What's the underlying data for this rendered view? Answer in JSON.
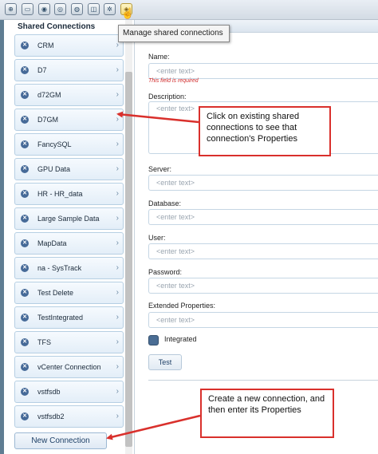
{
  "toolbar": {
    "tooltip": "Manage shared connections"
  },
  "sidebar": {
    "title": "Shared Connections",
    "items": [
      {
        "label": "CRM"
      },
      {
        "label": "D7"
      },
      {
        "label": "d72GM"
      },
      {
        "label": "D7GM"
      },
      {
        "label": "FancySQL"
      },
      {
        "label": "GPU Data"
      },
      {
        "label": "HR - HR_data"
      },
      {
        "label": "Large Sample Data"
      },
      {
        "label": "MapData"
      },
      {
        "label": "na - SysTrack"
      },
      {
        "label": "Test Delete"
      },
      {
        "label": "TestIntegrated"
      },
      {
        "label": "TFS"
      },
      {
        "label": "vCenter Connection"
      },
      {
        "label": "vstfsdb"
      },
      {
        "label": "vstfsdb2"
      }
    ],
    "new_connection_label": "New Connection"
  },
  "form": {
    "name_label": "Name:",
    "name_placeholder": "<enter text>",
    "required_msg": "This field is required",
    "description_label": "Description:",
    "description_placeholder": "<enter text>",
    "server_label": "Server:",
    "server_placeholder": "<enter text>",
    "database_label": "Database:",
    "database_placeholder": "<enter text>",
    "user_label": "User:",
    "user_placeholder": "<enter text>",
    "password_label": "Password:",
    "password_placeholder": "<enter text>",
    "extended_label": "Extended Properties:",
    "extended_placeholder": "<enter text>",
    "integrated_label": "Integrated",
    "integrated_checked": true,
    "test_button": "Test"
  },
  "callouts": {
    "existing": "Click on existing shared connections to see that connection's Properties",
    "new": "Create a new connection, and then enter its Properties"
  },
  "colors": {
    "callout_border": "#d9302c",
    "connection_icon": "#466a98",
    "required_text": "#d02a2a"
  }
}
